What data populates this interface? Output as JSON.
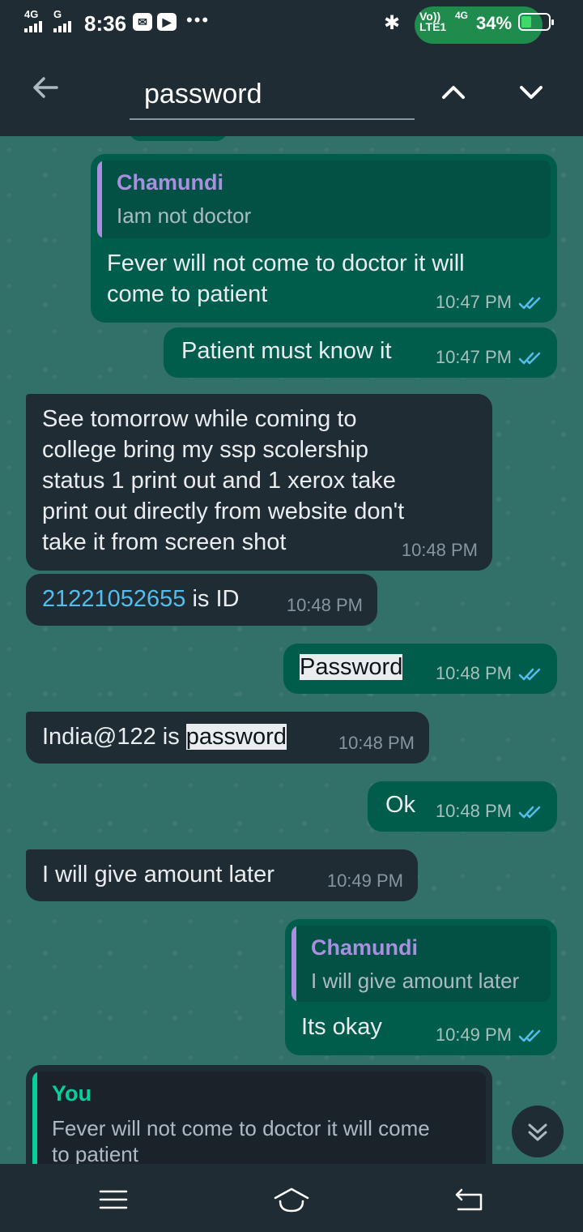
{
  "status_bar": {
    "network_left": "4G",
    "network_mid": "G",
    "time": "8:36",
    "lte_top": "Vo))",
    "lte_bottom": "LTE1",
    "network_right": "4G",
    "battery": "34%",
    "battery_level": 0.34
  },
  "search": {
    "query": "password"
  },
  "messages": [
    {
      "id": "m1",
      "direction": "out",
      "quote_author": "Chamundi",
      "quote_text": "Iam not doctor",
      "text_line1": "Fever will not come to doctor it will",
      "text_line2": "come to patient",
      "time": "10:47 PM"
    },
    {
      "id": "m2",
      "direction": "out",
      "text": "Patient must know it",
      "time": "10:47 PM"
    },
    {
      "id": "m3",
      "direction": "in",
      "lines": [
        "See tomorrow while coming to",
        "college bring my ssp scolership",
        "status 1 print out and 1 xerox take",
        "print out directly from website don't",
        "take it from screen shot"
      ],
      "time": "10:48 PM"
    },
    {
      "id": "m4",
      "direction": "in",
      "link": "21221052655",
      "text": " is ID",
      "time": "10:48 PM"
    },
    {
      "id": "m5",
      "direction": "out",
      "highlight": "Password",
      "time": "10:48 PM"
    },
    {
      "id": "m6",
      "direction": "in",
      "text": "India@122 is ",
      "highlight": "password",
      "time": "10:48 PM"
    },
    {
      "id": "m7",
      "direction": "out",
      "text": "Ok",
      "time": "10:48 PM"
    },
    {
      "id": "m8",
      "direction": "in",
      "text": "I will give amount later",
      "time": "10:49 PM"
    },
    {
      "id": "m9",
      "direction": "out",
      "quote_author": "Chamundi",
      "quote_text": "I will give amount later",
      "text": "Its okay",
      "time": "10:49 PM"
    },
    {
      "id": "m10",
      "direction": "in",
      "quote_author": "You",
      "quote_line1": "Fever will not come to doctor it will come",
      "quote_line2": "to patient"
    }
  ],
  "colors": {
    "quote_bar_contact": "#a98fe0",
    "quote_author_contact": "#a98fe0",
    "quote_author_you": "#06cf9c",
    "tick_read": "#53bdeb"
  }
}
